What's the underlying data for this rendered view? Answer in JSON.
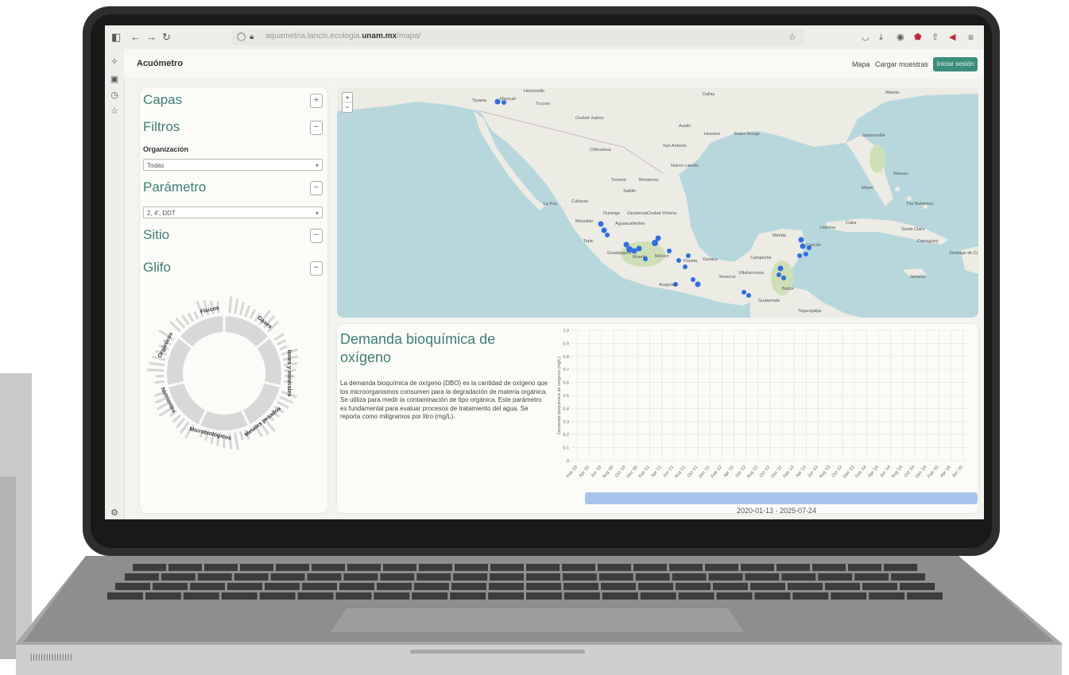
{
  "browser": {
    "url_host": "aquametria.lancis.ecologia.",
    "url_bold": "unam.mx",
    "url_path": "/mapa/",
    "toolbar_icons": [
      "sidebar-toggle-icon",
      "back-icon",
      "forward-icon",
      "reload-icon",
      "shield-icon",
      "lock-icon",
      "bookmark-star-icon",
      "pocket-icon",
      "download-icon",
      "account-icon",
      "extension-icon",
      "share-icon",
      "megaphone-icon",
      "menu-icon"
    ]
  },
  "app": {
    "title": "Acuómetro",
    "nav": [
      "Mapa",
      "Cargar muestras"
    ],
    "login_label": "Iniciar sesión",
    "accent": "#3c8d7b"
  },
  "panel": {
    "capas": {
      "title": "Capas",
      "toggle": "+"
    },
    "filtros": {
      "title": "Filtros",
      "toggle": "−"
    },
    "organizacion": {
      "label": "Organización",
      "value": "Todas"
    },
    "parametro": {
      "title": "Parámetro",
      "toggle": "−",
      "value": "2, 4', DDT"
    },
    "sitio": {
      "title": "Sitio",
      "toggle": "−"
    },
    "glifo": {
      "title": "Glifo",
      "toggle": "−",
      "segments": [
        "Orgánicos",
        "Físicos",
        "Gases",
        "Iones y minerales",
        "Metales pesados",
        "Microbiológicos",
        "Nutrientes"
      ]
    }
  },
  "map": {
    "zoom_in": "+",
    "zoom_out": "−",
    "labels": [
      "Tijuana",
      "Mexicali",
      "Hermosillo",
      "Tucson",
      "Ciudad Juárez",
      "Chihuahua",
      "Dallas",
      "Austin",
      "Houston",
      "Baton Rouge",
      "Atlanta",
      "Jacksonville",
      "San Antonio",
      "Nuevo Laredo",
      "Monterrey",
      "Saltillo",
      "Torreón",
      "Culiacán",
      "Durango",
      "La Paz",
      "Mazatlán",
      "Zacatecas",
      "Ciudad Victoria",
      "Aguascalientes",
      "Tepic",
      "Guadalajara",
      "Morelia",
      "México",
      "Puebla",
      "Acapulco",
      "Veracruz",
      "Oaxaca",
      "Villahermosa",
      "Mérida",
      "Campeche",
      "Cancún",
      "Belize",
      "Guatemala",
      "Tegucigalpa",
      "Miami",
      "Nassau",
      "The Bahamas",
      "Havana",
      "Cuba",
      "Santa Clara",
      "Camagüey",
      "Jamaica",
      "Santiago de Cuba"
    ]
  },
  "info": {
    "title": "Demanda bioquímica de oxígeno",
    "description": "La demanda bioquímica de oxígeno (DBO) es la cantidad de oxígeno que los microorganismos consumen para la degradación de materia orgánica. Se utiliza para medir la contaminación de tipo orgánica. Este parámetro es fundamental para evaluar procesos de tratamiento del agua. Se reporta como miligramos por litro (mg/L)."
  },
  "chart_data": {
    "type": "scatter",
    "title": "",
    "ylabel": "Demanda bioquímica de oxígeno (mg/L)",
    "xlabel": "",
    "ylim": [
      0,
      1
    ],
    "yticks": [
      "0",
      "0.1",
      "0.2",
      "0.3",
      "0.4",
      "0.5",
      "0.6",
      "0.7",
      "0.8",
      "0.9",
      "1.0"
    ],
    "xticks": [
      "Feb '20",
      "Apr '20",
      "Jun '20",
      "Aug '20",
      "Oct '20",
      "Dec '20",
      "Feb '21",
      "Apr '21",
      "Jun '21",
      "Aug '21",
      "Oct '21",
      "Dec '21",
      "Feb '22",
      "Apr '22",
      "Jun '22",
      "Aug '22",
      "Oct '22",
      "Dec '22",
      "Feb '23",
      "Apr '23",
      "Jun '23",
      "Aug '23",
      "Oct '23",
      "Dec '23",
      "Feb '24",
      "Apr '24",
      "Jun '24",
      "Aug '24",
      "Oct '24",
      "Dec '24",
      "Feb '25",
      "Apr '25",
      "Jun '25"
    ],
    "grid": true,
    "series": [],
    "range_label": "2020-01-13 - 2025-07-24"
  }
}
